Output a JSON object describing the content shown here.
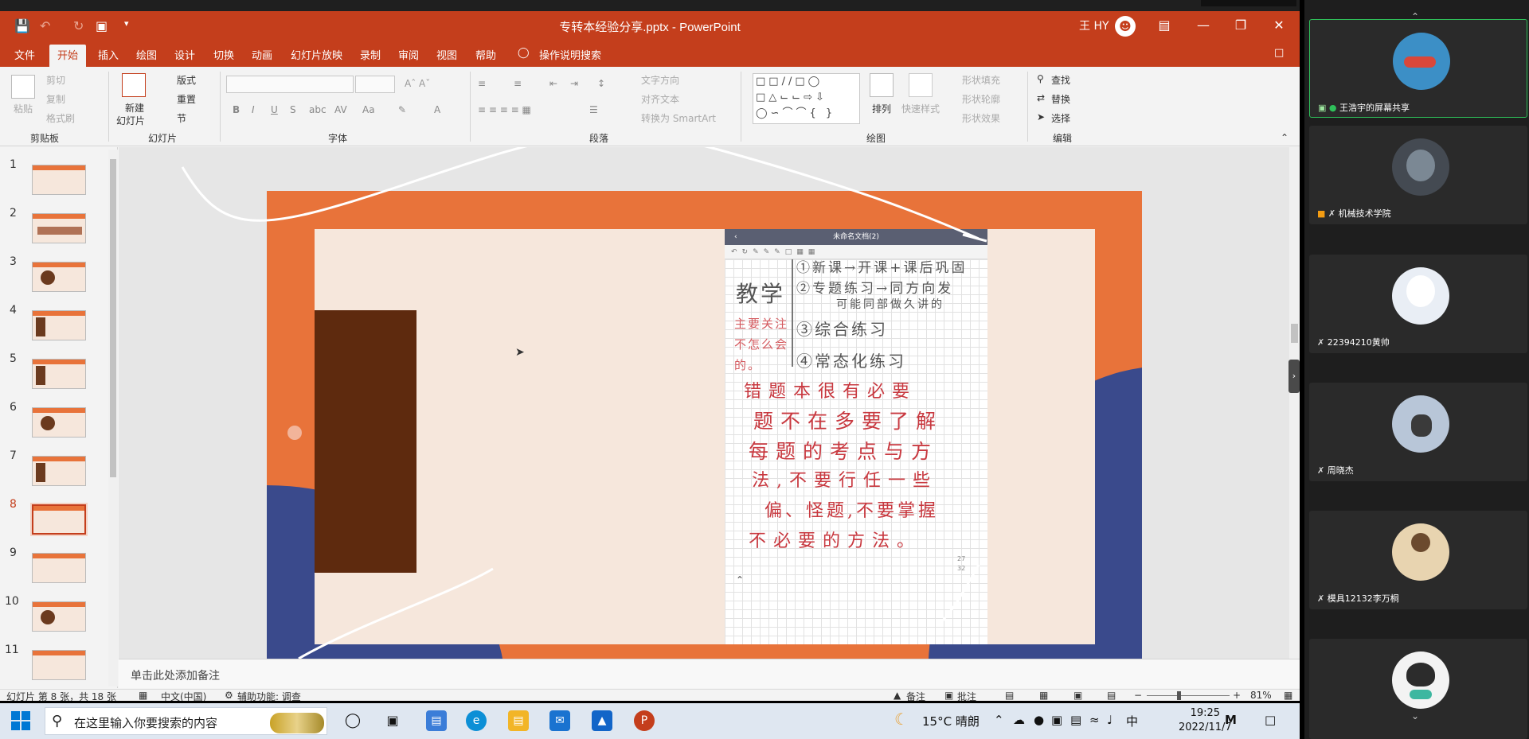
{
  "window": {
    "title": "专转本经验分享.pptx - PowerPoint",
    "user_name": "王 HY"
  },
  "tabs": [
    "文件",
    "开始",
    "插入",
    "绘图",
    "设计",
    "切换",
    "动画",
    "幻灯片放映",
    "录制",
    "审阅",
    "视图",
    "帮助"
  ],
  "active_tab": "开始",
  "tell_me": "操作说明搜索",
  "ribbon": {
    "clipboard": {
      "group": "剪贴板",
      "paste": "粘贴",
      "cut": "剪切",
      "copy": "复制",
      "format_painter": "格式刷"
    },
    "slides": {
      "group": "幻灯片",
      "new_slide_1": "新建",
      "new_slide_2": "幻灯片",
      "layout": "版式",
      "reset": "重置",
      "section": "节"
    },
    "font": {
      "group": "字体"
    },
    "paragraph": {
      "group": "段落",
      "text_direction": "文字方向",
      "align_text": "对齐文本",
      "smartart": "转换为 SmartArt"
    },
    "drawing": {
      "group": "绘图",
      "arrange": "排列",
      "quick_styles": "快速样式",
      "fill": "形状填充",
      "outline": "形状轮廓",
      "effects": "形状效果"
    },
    "editing": {
      "group": "编辑",
      "find": "查找",
      "replace": "替换",
      "select": "选择"
    }
  },
  "thumbnails": [
    {
      "num": "1"
    },
    {
      "num": "2"
    },
    {
      "num": "3"
    },
    {
      "num": "4"
    },
    {
      "num": "5"
    },
    {
      "num": "6"
    },
    {
      "num": "7"
    },
    {
      "num": "8"
    },
    {
      "num": "9"
    },
    {
      "num": "10"
    },
    {
      "num": "11"
    }
  ],
  "selected_slide": "8",
  "phone": {
    "doc_title": "未命名文档(2)",
    "left_big": "教学",
    "left_note": [
      "主要关注",
      "不怎么会",
      "的。"
    ],
    "lines": [
      "①新课→开课+课后巩固",
      "②专题练习→同方向发",
      "可能同部做久讲的",
      "③综合练习",
      "④常态化练习"
    ],
    "red_lines": [
      "错题本很有必要",
      "题不在多要了解",
      "每题的考点与方",
      "法,不要行任一些",
      "偏、怪题,不要掌握",
      "不必要的方法。"
    ],
    "page_marks": [
      "27",
      "32"
    ]
  },
  "notes_placeholder": "单击此处添加备注",
  "status": {
    "slide_info": "幻灯片 第 8 张，共 18 张",
    "language": "中文(中国)",
    "accessibility": "辅助功能: 调查",
    "notes": "备注",
    "comments": "批注",
    "zoom": "81%"
  },
  "taskbar": {
    "search_placeholder": "在这里输入你要搜索的内容",
    "weather": "15°C 晴朗",
    "ime": "中",
    "time": "19:25",
    "date": "2022/11/7"
  },
  "meeting": {
    "participants": [
      {
        "name": "王浩宇的屏幕共享",
        "avatar_color": "#3c8fc6"
      },
      {
        "name": "机械技术学院",
        "avatar_color": "#444a52"
      },
      {
        "name": "22394210黄帅",
        "avatar_color": "#e9eef5"
      },
      {
        "name": "周晓杰",
        "avatar_color": "#b8c6d8"
      },
      {
        "name": "模具12132李万桐",
        "avatar_color": "#e8d4b0"
      },
      {
        "name": "",
        "avatar_color": "#f3f3f3"
      }
    ]
  },
  "colors": {
    "ppt_accent": "#c43e1c",
    "slide_orange": "#e8733a",
    "slide_blue": "#3a4a8c",
    "slide_cream": "#f6e7dc",
    "slide_brown": "#5e2a0e"
  }
}
